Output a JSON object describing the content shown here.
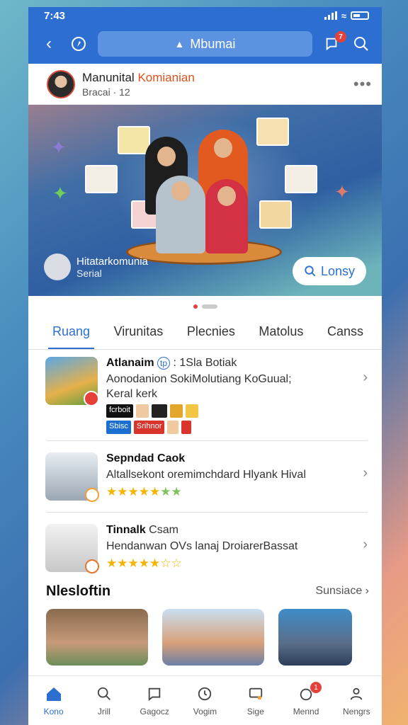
{
  "status": {
    "time": "7:43"
  },
  "header": {
    "search_title": "Mbumai",
    "notif_count": "7"
  },
  "profile": {
    "name_a": "Manunital",
    "name_b": "Komianian",
    "sub": "Bracai · 12"
  },
  "banner": {
    "user_name": "Hitatarkomunia",
    "user_sub": "Serial",
    "login_label": "Lonsy"
  },
  "tabs": [
    "Ruang",
    "Virunitas",
    "Plecnies",
    "Matolus",
    "Canss"
  ],
  "list": [
    {
      "title": "Atlanaim",
      "badge": "tp",
      "title_rest": ": 1Sla Botiak",
      "desc1": "Aonodanion SokiMolutiang KoGuual;",
      "desc2": "Keral kerk",
      "tags": [
        "fcrboit",
        "Sbisc",
        "Srihnor"
      ]
    },
    {
      "title": "Sepndad Caok",
      "desc1": "Altallsekont oremimchdard Hlyank Hival",
      "stars": "★★★★★",
      "stars_g": "★★"
    },
    {
      "title": "Tinnalk",
      "title_rest": "Csam",
      "desc1": "Hendanwan OVs lanaj DroiarerBassat",
      "stars": "★★★★★",
      "stars_g": "☆☆"
    }
  ],
  "section": {
    "title": "Nlesloftin",
    "link": "Sunsiace"
  },
  "bottom_nav": [
    "Kono",
    "Jrill",
    "Gagocz",
    "Vogim",
    "Sige",
    "Mennd",
    "Nengrs"
  ],
  "bottom_badge": "1",
  "colors": {
    "primary": "#2c6fd0",
    "accent": "#e0501c",
    "badge": "#e5403a"
  }
}
